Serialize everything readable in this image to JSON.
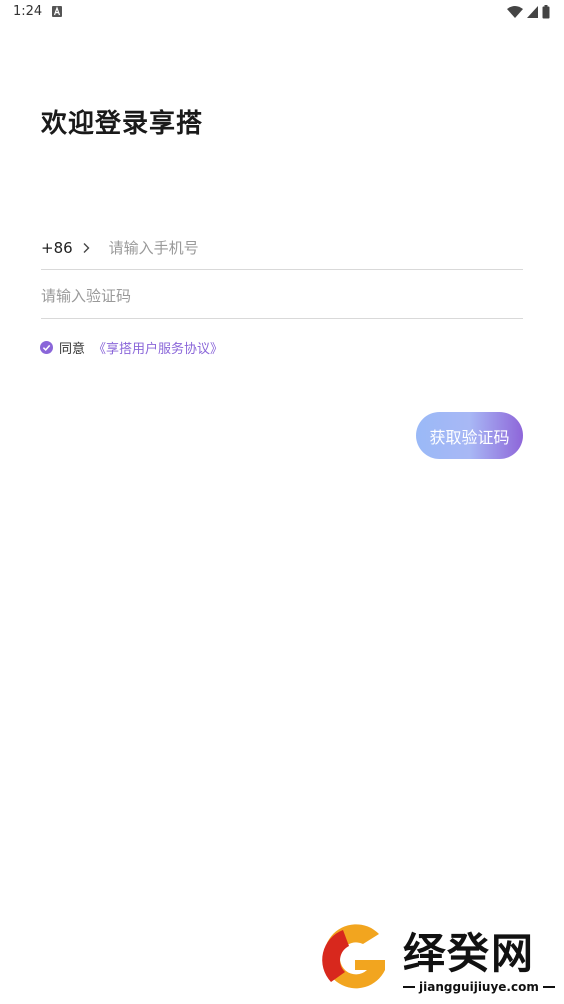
{
  "status_bar": {
    "time": "1:24",
    "notification_icon": "a-letter-icon",
    "wifi_icon": "wifi-icon",
    "signal_icon": "signal-icon",
    "battery_icon": "battery-icon"
  },
  "login": {
    "title": "欢迎登录享搭",
    "country_code": "+86",
    "phone_placeholder": "请输入手机号",
    "code_placeholder": "请输入验证码",
    "agree_checked": true,
    "agree_label": "同意",
    "agreement_link": "《享搭用户服务协议》",
    "get_code_button": "获取验证码"
  },
  "colors": {
    "accent": "#8a66d9",
    "button_gradient_start": "#9ab9f7",
    "button_gradient_end": "#8e66d9"
  },
  "watermark": {
    "name": "绎癸网",
    "url": "jiangguijiuye.com"
  }
}
